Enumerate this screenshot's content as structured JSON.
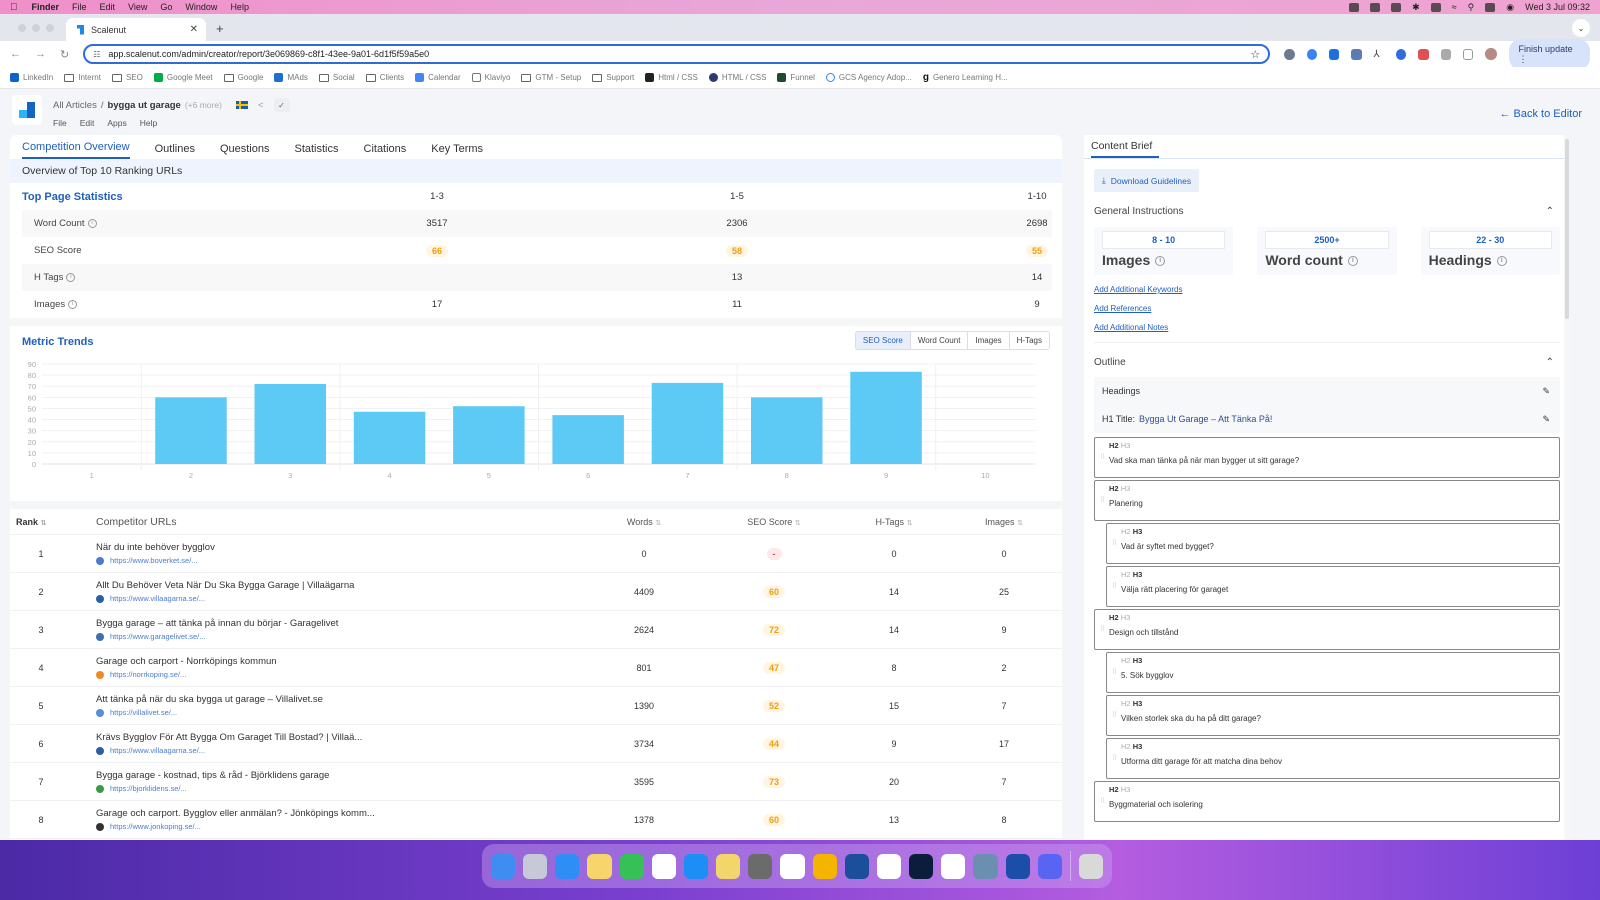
{
  "menubar": {
    "app": "Finder",
    "items": [
      "File",
      "Edit",
      "View",
      "Go",
      "Window",
      "Help"
    ],
    "clock": "Wed 3 Jul  09:32"
  },
  "browser": {
    "tab_title": "Scalenut",
    "url": "app.scalenut.com/admin/creator/report/3e069869-c8f1-43ee-9a01-6d1f5f59a5e0",
    "finish_update": "Finish update",
    "extension_badge": "1",
    "bookmarks": [
      {
        "label": "LinkedIn",
        "icon": "linkedin-icon"
      },
      {
        "label": "Internt",
        "icon": "folder-icon"
      },
      {
        "label": "SEO",
        "icon": "folder-icon"
      },
      {
        "label": "Google Meet",
        "icon": "google-meet-icon"
      },
      {
        "label": "Google",
        "icon": "folder-icon"
      },
      {
        "label": "MAds",
        "icon": "mads-icon"
      },
      {
        "label": "Social",
        "icon": "folder-icon"
      },
      {
        "label": "Clients",
        "icon": "folder-icon"
      },
      {
        "label": "Calendar",
        "icon": "calendar-icon"
      },
      {
        "label": "Klaviyo",
        "icon": "klaviyo-icon"
      },
      {
        "label": "GTM - Setup",
        "icon": "folder-icon"
      },
      {
        "label": "Support",
        "icon": "folder-icon"
      },
      {
        "label": "Html / CSS",
        "icon": "html-icon"
      },
      {
        "label": "HTML / CSS",
        "icon": "html-icon"
      },
      {
        "label": "Funnel",
        "icon": "funnel-icon"
      },
      {
        "label": "GCS Agency Adop...",
        "icon": "gcs-icon"
      },
      {
        "label": "Genero Learning H...",
        "icon": "genero-icon"
      }
    ]
  },
  "app": {
    "breadcrumb": {
      "root": "All Articles",
      "separator": "/",
      "current": "bygga ut garage",
      "more": "(+6 more)"
    },
    "menu": [
      "File",
      "Edit",
      "Apps",
      "Help"
    ],
    "back_to_editor": "← Back to Editor",
    "tabs": [
      "Competition Overview",
      "Outlines",
      "Questions",
      "Statistics",
      "Citations",
      "Key Terms"
    ],
    "active_tab": "Competition Overview",
    "overview_title": "Overview of Top 10 Ranking URLs",
    "top_stats": {
      "title": "Top Page Statistics",
      "columns": [
        "1-3",
        "1-5",
        "1-10"
      ],
      "rows": [
        {
          "label": "Word Count",
          "info": true,
          "values": [
            "3517",
            "2306",
            "2698"
          ]
        },
        {
          "label": "SEO Score",
          "info": false,
          "values": [
            "66",
            "58",
            "55"
          ],
          "pill": true
        },
        {
          "label": "H Tags",
          "info": true,
          "values": [
            "",
            "13",
            "14"
          ]
        },
        {
          "label": "Images",
          "info": true,
          "values": [
            "17",
            "11",
            "9"
          ]
        }
      ]
    },
    "metric_trends": {
      "title": "Metric Trends",
      "buttons": [
        "SEO Score",
        "Word Count",
        "Images",
        "H-Tags"
      ],
      "active": "SEO Score"
    },
    "competitors": {
      "headers": {
        "rank": "Rank",
        "urls": "Competitor URLs",
        "words": "Words",
        "seo": "SEO Score",
        "htags": "H-Tags",
        "images": "Images"
      },
      "rows": [
        {
          "rank": "1",
          "title": "När du inte behöver bygglov",
          "url": "https://www.boverket.se/...",
          "fav_color": "#4a7cd1",
          "words": "0",
          "seo": "-",
          "htags": "0",
          "images": "0"
        },
        {
          "rank": "2",
          "title": "Allt Du Behöver Veta När Du Ska Bygga Garage | Villaägarna",
          "url": "https://www.villaagarna.se/...",
          "fav_color": "#2c5ea8",
          "words": "4409",
          "seo": "60",
          "htags": "14",
          "images": "25"
        },
        {
          "rank": "3",
          "title": "Bygga garage – att tänka på innan du börjar - Garagelivet",
          "url": "https://www.garagelivet.se/...",
          "fav_color": "#3a6fb0",
          "words": "2624",
          "seo": "72",
          "htags": "14",
          "images": "9"
        },
        {
          "rank": "4",
          "title": "Garage och carport - Norrköpings kommun",
          "url": "https://norrkoping.se/...",
          "fav_color": "#f08a24",
          "words": "801",
          "seo": "47",
          "htags": "8",
          "images": "2"
        },
        {
          "rank": "5",
          "title": "Att tänka på när du ska bygga ut garage – Villalivet.se",
          "url": "https://villalivet.se/...",
          "fav_color": "#5b8bd8",
          "words": "1390",
          "seo": "52",
          "htags": "15",
          "images": "7"
        },
        {
          "rank": "6",
          "title": "Krävs Bygglov För Att Bygga Om Garaget Till Bostad? | Villaä...",
          "url": "https://www.villaagarna.se/...",
          "fav_color": "#2c5ea8",
          "words": "3734",
          "seo": "44",
          "htags": "9",
          "images": "17"
        },
        {
          "rank": "7",
          "title": "Bygga garage - kostnad, tips & råd - Björklidens garage",
          "url": "https://bjorklidens.se/...",
          "fav_color": "#3a9a4a",
          "words": "3595",
          "seo": "73",
          "htags": "20",
          "images": "7"
        },
        {
          "rank": "8",
          "title": "Garage och carport. Bygglov eller anmälan? - Jönköpings komm...",
          "url": "https://www.jonkoping.se/...",
          "fav_color": "#333333",
          "words": "1378",
          "seo": "60",
          "htags": "13",
          "images": "8"
        }
      ]
    },
    "content_brief": {
      "tab": "Content Brief",
      "download": "Download Guidelines",
      "general_instructions": "General Instructions",
      "cards": [
        {
          "range": "8 - 10",
          "name": "Images"
        },
        {
          "range": "2500+",
          "name": "Word count"
        },
        {
          "range": "22 - 30",
          "name": "Headings"
        }
      ],
      "links": [
        "Add Additional Keywords",
        "Add References",
        "Add Additional Notes"
      ],
      "outline": "Outline",
      "headings_label": "Headings",
      "h1_label": "H1 Title:",
      "h1_value": "Bygga Ut Garage – Att Tänka På!",
      "level_h2": "H2",
      "level_h3": "H3",
      "headings": [
        {
          "level": "H2",
          "text": "Vad ska man tänka på när man bygger ut sitt garage?"
        },
        {
          "level": "H2",
          "text": "Planering"
        },
        {
          "level": "H3",
          "text": "Vad är syftet med bygget?"
        },
        {
          "level": "H3",
          "text": "Välja rätt placering för garaget"
        },
        {
          "level": "H2",
          "text": "Design och tillstånd"
        },
        {
          "level": "H3",
          "text": "5. Sök bygglov"
        },
        {
          "level": "H3",
          "text": "Vilken storlek ska du ha på ditt garage?"
        },
        {
          "level": "H3",
          "text": "Utforma ditt garage för att matcha dina behov"
        },
        {
          "level": "H2",
          "text": "Byggmaterial och isolering"
        }
      ]
    }
  },
  "dock": [
    "Finder",
    "Launchpad",
    "Safari",
    "Notes",
    "Numbers",
    "Calendar",
    "App Store",
    "Stickies",
    "System Settings",
    "Chrome",
    "Google Ads",
    "Azure",
    "Slack",
    "Photoshop",
    "Teams",
    "Preview",
    "1Password",
    "Discord",
    "Trash"
  ],
  "colors": {
    "accent": "#1f5fbf",
    "bar": "#5ccaf5",
    "score": "#f29d0f"
  },
  "chart_data": {
    "type": "bar",
    "title": "Metric Trends",
    "metric": "SEO Score",
    "categories": [
      "1",
      "2",
      "3",
      "4",
      "5",
      "6",
      "7",
      "8",
      "9",
      "10"
    ],
    "values": [
      0,
      60,
      72,
      47,
      52,
      44,
      73,
      60,
      83,
      0
    ],
    "xlabel": "",
    "ylabel": "",
    "ylim": [
      0,
      90
    ],
    "yticks": [
      0,
      10,
      20,
      30,
      40,
      50,
      60,
      70,
      80,
      90
    ],
    "grid": true
  }
}
